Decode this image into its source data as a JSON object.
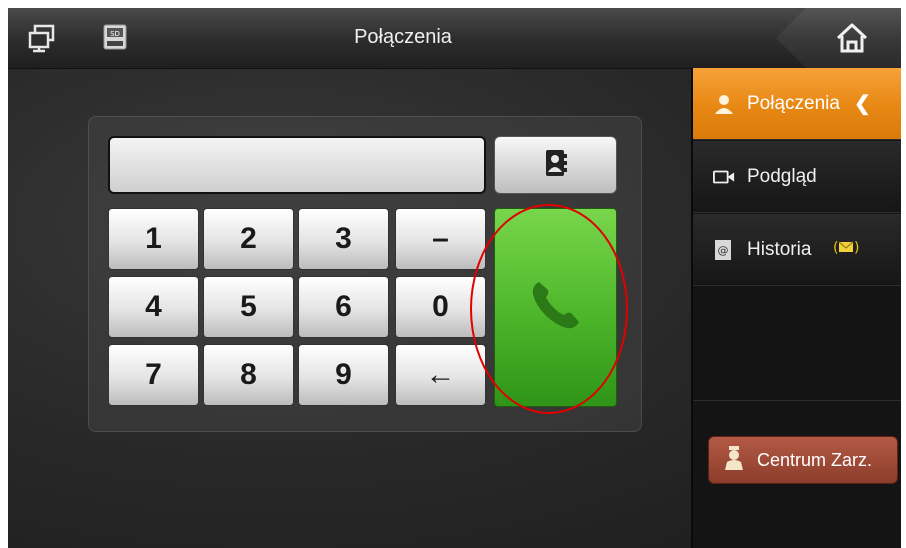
{
  "header": {
    "title": "Połączenia",
    "icons": [
      "window-switch-icon",
      "sd-card-icon",
      "home-icon"
    ]
  },
  "dialer": {
    "number_value": "",
    "contacts_icon": "contacts-book-icon",
    "keys": [
      {
        "label": "1"
      },
      {
        "label": "2"
      },
      {
        "label": "3"
      },
      {
        "label": "–"
      },
      {
        "label": "4"
      },
      {
        "label": "5"
      },
      {
        "label": "6"
      },
      {
        "label": "0"
      },
      {
        "label": "7"
      },
      {
        "label": "8"
      },
      {
        "label": "9"
      },
      {
        "label": "←"
      }
    ],
    "call_icon": "phone-handset-icon",
    "call_color": "#4cb52a"
  },
  "sidebar": {
    "items": [
      {
        "label": "Połączenia",
        "icon": "user-icon",
        "active": true
      },
      {
        "label": "Podgląd",
        "icon": "camera-icon",
        "active": false
      },
      {
        "label": "Historia",
        "icon": "mail-at-icon",
        "badge_icon": "envelope-icon",
        "active": false
      }
    ],
    "management_button": {
      "label": "Centrum Zarz.",
      "icon": "concierge-icon"
    }
  },
  "colors": {
    "accent": "#e98a16",
    "highlight_ring": "#e10000",
    "management": "#8c3d2b"
  }
}
